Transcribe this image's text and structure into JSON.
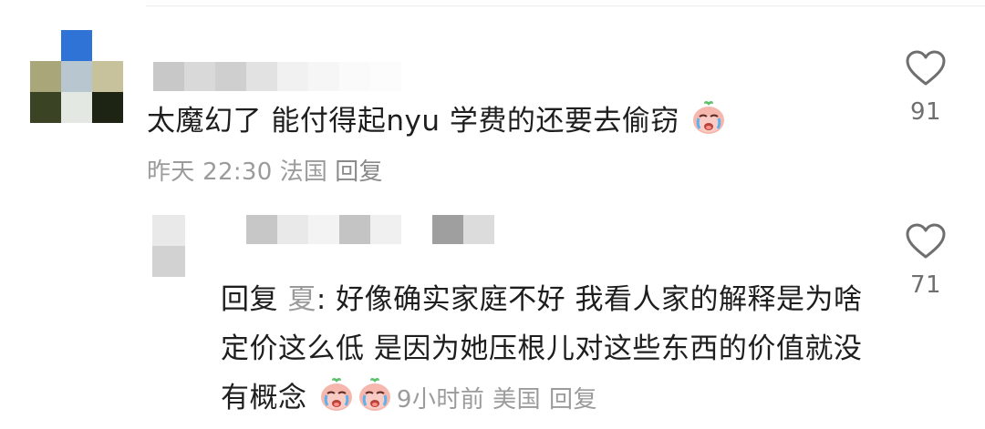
{
  "comment": {
    "text": "太魔幻了 能付得起nyu 学费的还要去偷窃",
    "emoji": "crying-face-emoji",
    "time": "昨天 22:30",
    "location": "法国",
    "reply_label": "回复",
    "likes": "91"
  },
  "reply": {
    "prefix": "回复",
    "target": "夏",
    "text": ": 好像确实家庭不好 我看人家的解释是为啥定价这么低 是因为她压根儿对这些东西的价值就没有概念",
    "emoji": "crying-face-emoji",
    "time": "9小时前",
    "location": "美国",
    "reply_label": "回复",
    "likes": "71"
  },
  "colors": {
    "meta": "#9b9b9b",
    "text": "#1e1e1e",
    "heart": "#6f6f6f",
    "avatar_main": [
      "#ffffff",
      "#2f73d6",
      "#ffffff",
      "#a9a77a",
      "#b7c6cf",
      "#c8c29c",
      "#3a4424",
      "#e4e8e2",
      "#1d2414"
    ],
    "avatar_reply": [
      "#e9e9e9",
      "#d2d2d2"
    ]
  }
}
